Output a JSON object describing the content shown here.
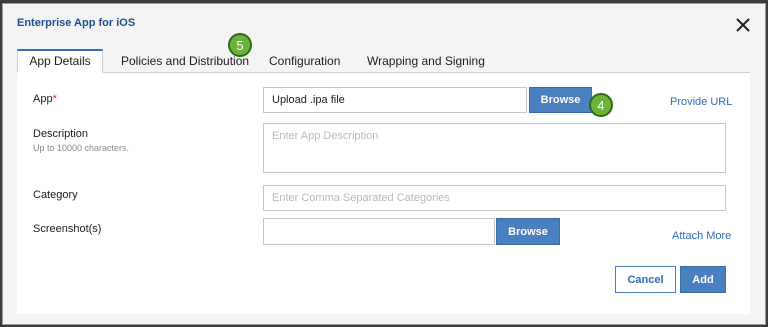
{
  "dialog": {
    "title": "Enterprise App for iOS",
    "close_icon": "close-icon"
  },
  "tabs": [
    {
      "label": "App Details",
      "active": true
    },
    {
      "label": "Policies and Distribution",
      "active": false
    },
    {
      "label": "Configuration",
      "active": false
    },
    {
      "label": "Wrapping and Signing",
      "active": false
    }
  ],
  "badges": {
    "tabs_step": "5",
    "browse_step": "4"
  },
  "form": {
    "app": {
      "label": "App",
      "required_mark": "*",
      "file_value": "Upload .ipa file",
      "browse_label": "Browse",
      "provide_url_label": "Provide URL"
    },
    "description": {
      "label": "Description",
      "hint": "Up to 10000 characters.",
      "placeholder": "Enter App Description"
    },
    "category": {
      "label": "Category",
      "placeholder": "Enter Comma Separated Categories"
    },
    "screenshots": {
      "label": "Screenshot(s)",
      "value": "",
      "browse_label": "Browse",
      "attach_more_label": "Attach More"
    }
  },
  "footer": {
    "cancel_label": "Cancel",
    "add_label": "Add"
  },
  "colors": {
    "accent": "#4a7fc0",
    "badge": "#6cb33e",
    "title": "#1f4e8c"
  }
}
